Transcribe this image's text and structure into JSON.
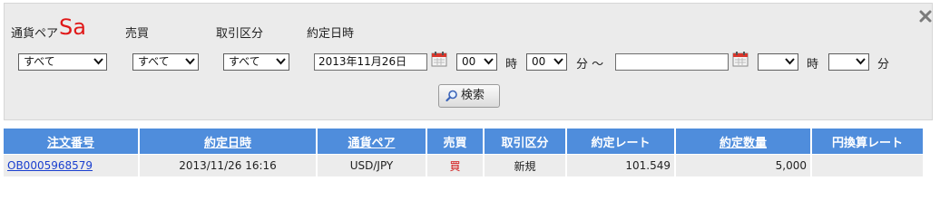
{
  "filter": {
    "overlay_text": "Sa",
    "labels": {
      "pair": "通貨ペア",
      "side": "売買",
      "trade_type": "取引区分",
      "exec_datetime": "約定日時"
    },
    "pair_select": "すべて",
    "side_select": "すべて",
    "trade_type_select": "すべて",
    "from_date": "2013年11月26日",
    "from_hour": "00",
    "hour_unit": "時",
    "from_minute": "00",
    "minute_unit_tilde": "分 ～",
    "to_date": "",
    "to_hour": "",
    "to_hour_unit": "時",
    "to_minute": "",
    "to_minute_unit": "分",
    "search_label": "検索",
    "close_icon": "close-x-icon",
    "calendar_icon": "calendar-icon",
    "search_icon": "magnifier-icon"
  },
  "table": {
    "headers": [
      "注文番号",
      "約定日時",
      "通貨ペア",
      "売買",
      "取引区分",
      "約定レート",
      "約定数量",
      "円換算レート"
    ],
    "rows": [
      {
        "order_no": "OB0005968579",
        "exec_datetime": "2013/11/26 16:16",
        "pair": "USD/JPY",
        "side": "買",
        "trade_type": "新規",
        "rate": "101.549",
        "quantity": "5,000",
        "jpy_rate": ""
      }
    ]
  },
  "colors": {
    "header_bg": "#4f8ddc",
    "row_bg": "#ececec",
    "panel_bg": "#ebebeb",
    "overlay_red": "#e01818",
    "buy_red": "#d11212",
    "link_blue": "#1a3fcf"
  }
}
